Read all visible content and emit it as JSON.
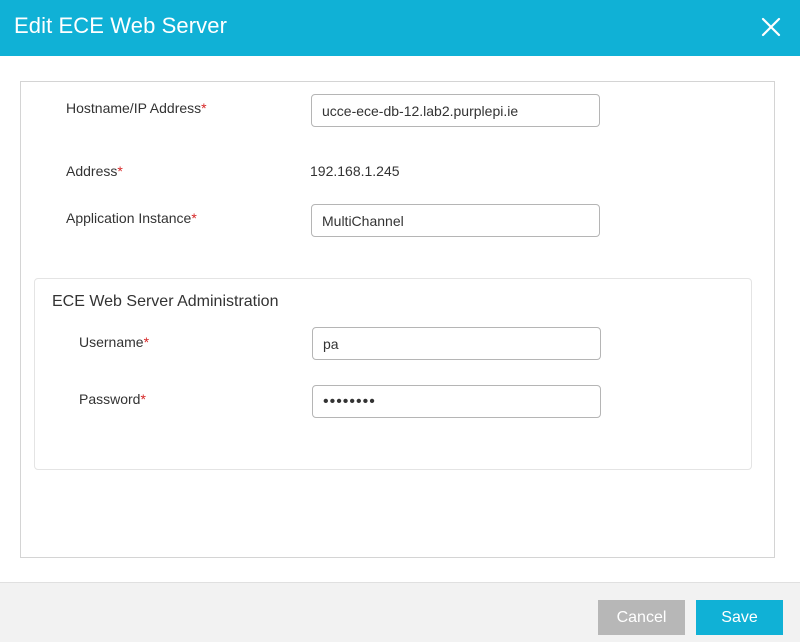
{
  "dialog": {
    "title": "Edit ECE Web Server",
    "close_icon": "close-icon"
  },
  "form": {
    "hostname": {
      "label": "Hostname/IP Address",
      "required_mark": "*",
      "value": "ucce-ece-db-12.lab2.purplepi.ie"
    },
    "address": {
      "label": "Address",
      "required_mark": "*",
      "value": "192.168.1.245"
    },
    "application_instance": {
      "label": "Application Instance",
      "required_mark": "*",
      "value": "MultiChannel"
    }
  },
  "administration": {
    "title": "ECE Web Server Administration",
    "username": {
      "label": "Username",
      "required_mark": "*",
      "value": "pa"
    },
    "password": {
      "label": "Password",
      "required_mark": "*",
      "value": "••••••••"
    }
  },
  "footer": {
    "cancel_label": "Cancel",
    "save_label": "Save"
  },
  "colors": {
    "accent": "#10b1d6",
    "required": "#d62525",
    "cancel_bg": "#b7b7b7",
    "footer_bg": "#f2f2f2"
  }
}
